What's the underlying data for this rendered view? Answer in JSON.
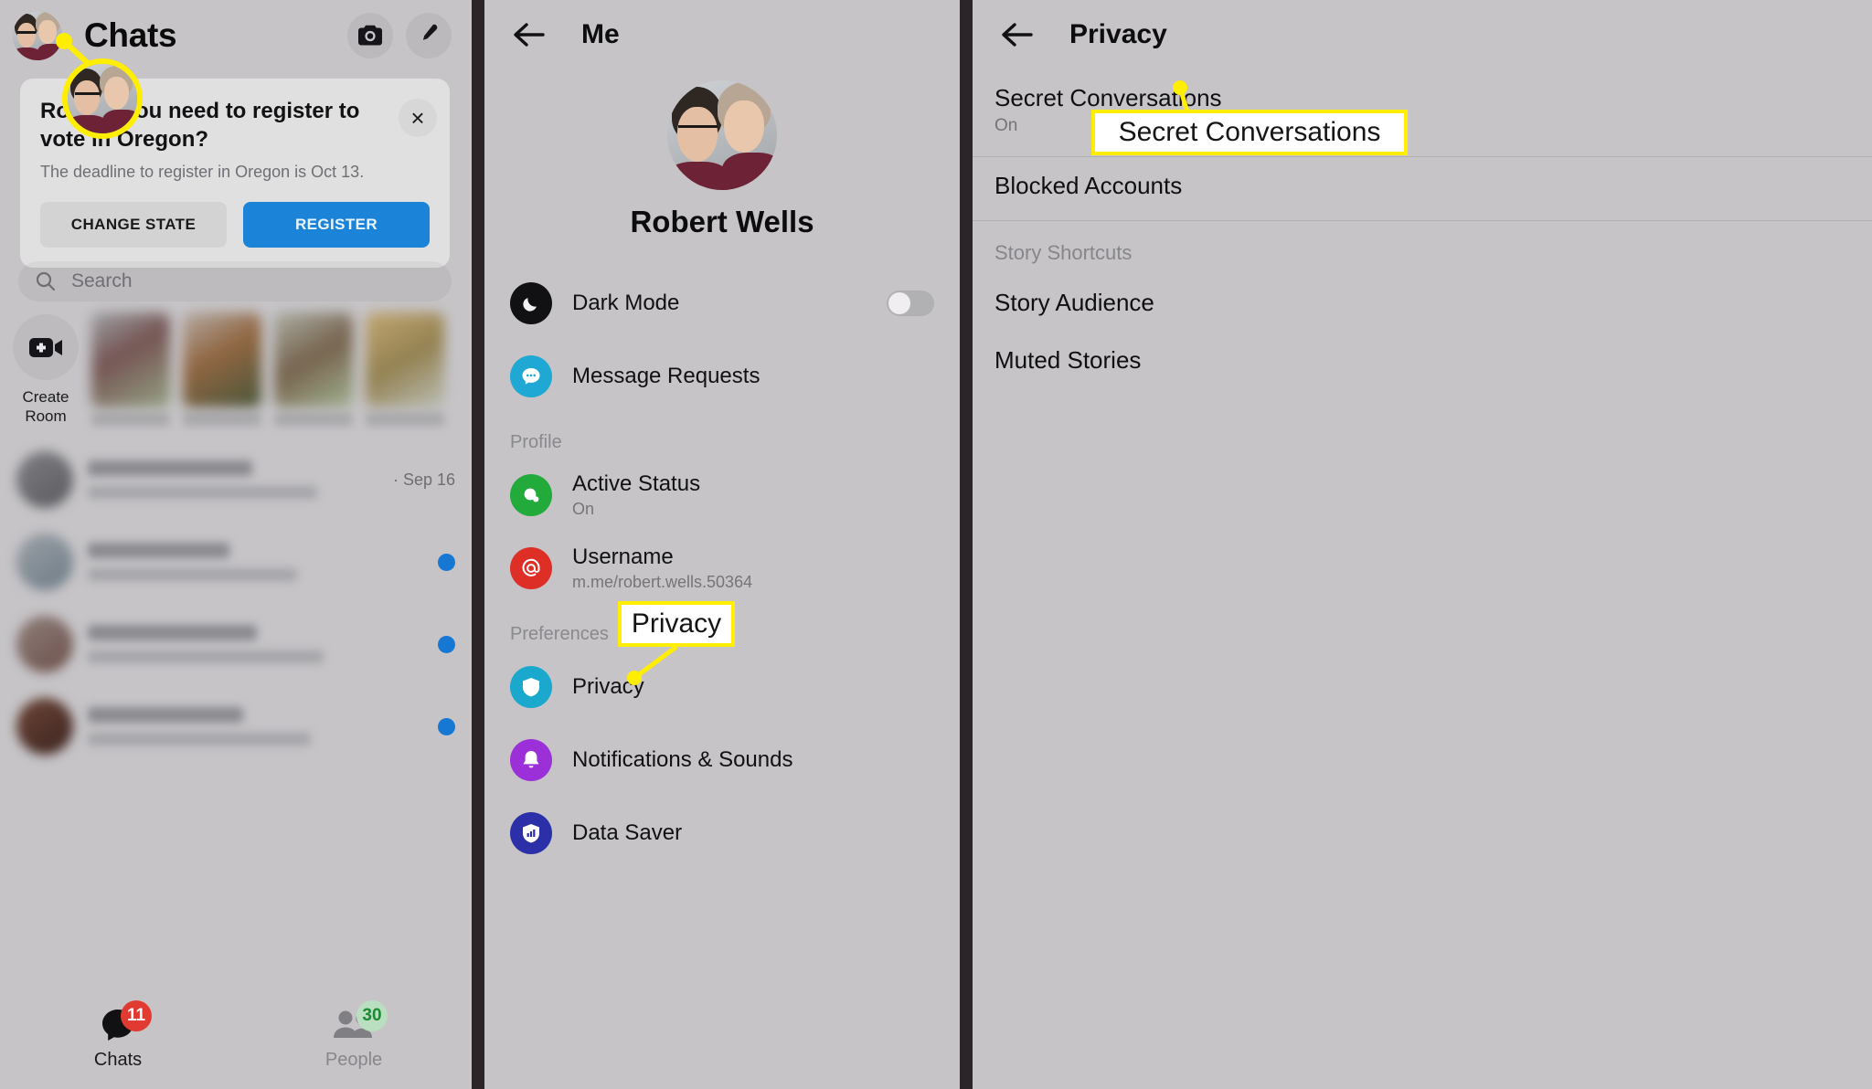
{
  "colors": {
    "highlight": "#ffee00",
    "primary_button": "#1b84d8",
    "badge_red": "#e03a31",
    "badge_green_bg": "#b9dfc0",
    "unread_dot": "#1778d4",
    "panel_bg": "#c6c4c7",
    "divider": "#2b2528"
  },
  "panel_chats": {
    "title": "Chats",
    "avatar_name": "profile-avatar",
    "actions": [
      {
        "name": "camera-icon",
        "label": "Camera"
      },
      {
        "name": "compose-icon",
        "label": "New message"
      }
    ],
    "notification_card": {
      "title": "Robert, you need to register to vote in Oregon?",
      "subtitle": "The deadline to register in Oregon is Oct 13.",
      "close_label": "×",
      "secondary_button": "CHANGE STATE",
      "primary_button": "REGISTER"
    },
    "search": {
      "placeholder": "Search"
    },
    "create_room": {
      "label_line1": "Create",
      "label_line2": "Room"
    },
    "room_thumbs": [
      {
        "name": "Meredith"
      },
      {
        "name": "Kinsey"
      },
      {
        "name": "Keens Park"
      },
      {
        "name": "Rodgers"
      }
    ],
    "chat_rows": [
      {
        "date": "· Sep 16",
        "unread": false
      },
      {
        "date": "",
        "unread": true
      },
      {
        "date": "",
        "unread": true
      },
      {
        "date": "",
        "unread": true
      }
    ],
    "nav": [
      {
        "label": "Chats",
        "badge": "11",
        "icon": "chat-bubble-icon",
        "active": true
      },
      {
        "label": "People",
        "badge": "30",
        "icon": "people-icon",
        "active": false
      }
    ]
  },
  "panel_me": {
    "back_label": "Back",
    "title": "Me",
    "profile_name": "Robert Wells",
    "items": [
      {
        "label": "Dark Mode",
        "sub": "",
        "icon": "moon-icon",
        "icon_color": "#111113",
        "toggle": true,
        "toggle_on": false
      },
      {
        "label": "Message Requests",
        "sub": "",
        "icon": "message-bubble-icon",
        "icon_color": "#1fa8d4",
        "toggle": false
      }
    ],
    "section_profile": "Profile",
    "profile_items": [
      {
        "label": "Active Status",
        "sub": "On",
        "icon": "active-status-icon",
        "icon_color": "#22ab3b"
      },
      {
        "label": "Username",
        "sub": "m.me/robert.wells.50364",
        "icon": "at-sign-icon",
        "icon_color": "#dd2f26"
      }
    ],
    "section_preferences": "Preferences",
    "preference_items": [
      {
        "label": "Privacy",
        "sub": "",
        "icon": "shield-icon",
        "icon_color": "#1aa8cc"
      },
      {
        "label": "Notifications & Sounds",
        "sub": "",
        "icon": "bell-icon",
        "icon_color": "#9b30d9"
      },
      {
        "label": "Data Saver",
        "sub": "",
        "icon": "data-saver-shield-icon",
        "icon_color": "#2b2fa8"
      }
    ]
  },
  "panel_privacy": {
    "back_label": "Back",
    "title": "Privacy",
    "items": [
      {
        "label": "Secret Conversations",
        "sub": "On",
        "separator": true
      },
      {
        "label": "Blocked Accounts",
        "sub": "",
        "separator": true
      }
    ],
    "section_story": "Story Shortcuts",
    "story_items": [
      {
        "label": "Story Audience",
        "sub": ""
      },
      {
        "label": "Muted Stories",
        "sub": ""
      }
    ]
  },
  "callouts": {
    "privacy": "Privacy",
    "secret": "Secret Conversations"
  }
}
